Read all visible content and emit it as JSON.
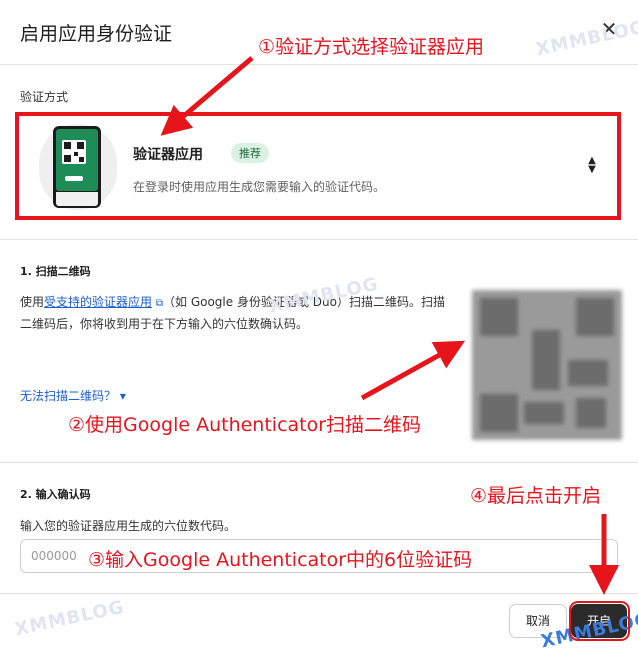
{
  "dialog": {
    "title": "启用应用身份验证",
    "close_glyph": "✕"
  },
  "method": {
    "label": "验证方式",
    "name": "验证器应用",
    "badge": "推荐",
    "description": "在登录时使用应用生成您需要输入的验证代码。",
    "selector_glyph": "⬍"
  },
  "step1": {
    "title": "1. 扫描二维码",
    "text_before": "使用",
    "link": "受支持的验证器应用",
    "text_after": "（如 Google 身份验证器或 Duo）扫描二维码。扫描二维码后，你将收到用于在下方输入的六位数确认码。",
    "cant_scan": "无法扫描二维码？ ▾"
  },
  "step2": {
    "title": "2. 输入确认码",
    "subtitle": "输入您的验证器应用生成的六位数代码。",
    "input_placeholder": "000000",
    "input_value": ""
  },
  "footer": {
    "cancel": "取消",
    "enable": "开启"
  },
  "annotations": {
    "a1": "①验证方式选择验证器应用",
    "a2": "②使用Google Authenticator扫描二维码",
    "a3": "③输入Google Authenticator中的6位验证码",
    "a4": "④最后点击开启"
  },
  "watermarks": [
    "XMMBLOG",
    "XMMBLOG",
    "XMMBLOG",
    "XMMBLOG"
  ],
  "colors": {
    "annotation_red": "#e8141b",
    "link_blue": "#1a5fcf",
    "badge_bg": "#d9f2e3",
    "badge_fg": "#1e6b3f",
    "primary_button": "#2b2b2b"
  }
}
